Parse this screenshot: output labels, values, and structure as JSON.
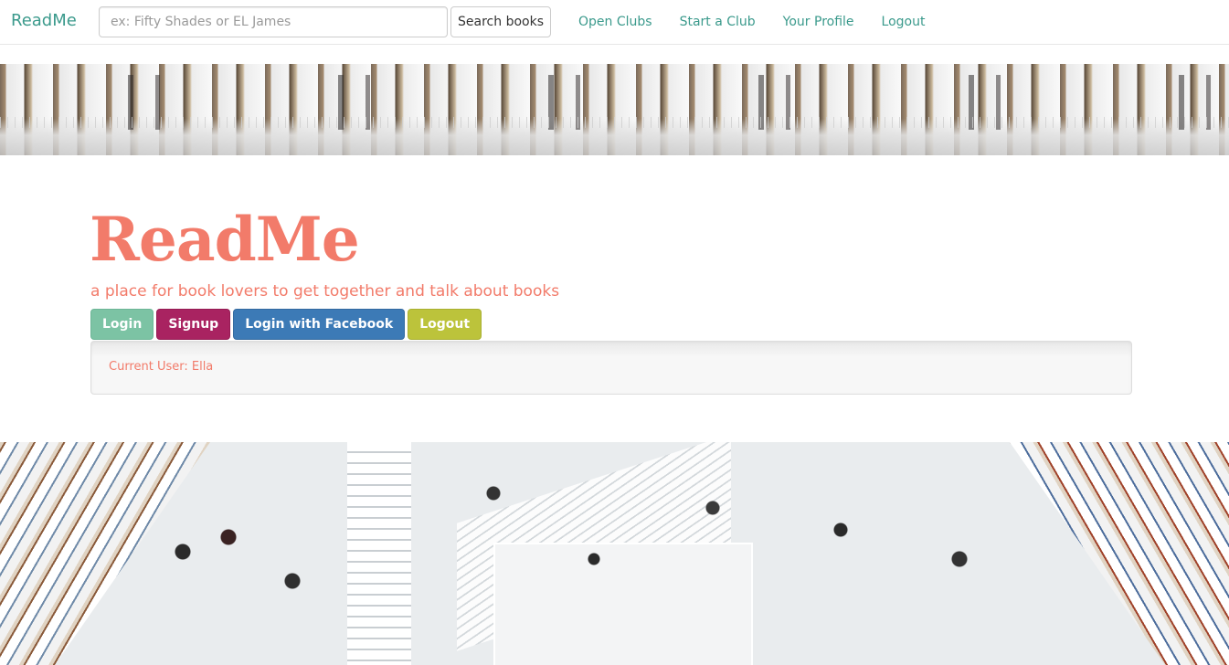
{
  "navbar": {
    "brand": "ReadMe",
    "search_placeholder": "ex: Fifty Shades or EL James",
    "search_button": "Search books",
    "links": [
      "Open Clubs",
      "Start a Club",
      "Your Profile",
      "Logout"
    ]
  },
  "hero": {
    "title": "ReadMe",
    "tagline": "a place for book lovers to get together and talk about books",
    "buttons": {
      "login": "Login",
      "signup": "Signup",
      "facebook": "Login with Facebook",
      "logout": "Logout"
    },
    "current_user": "Current User: Ella"
  },
  "colors": {
    "accent": "#f27b6a",
    "nav_link": "#3b9a8c",
    "login": "#7cc3a4",
    "signup": "#a92361",
    "facebook": "#3c7ab6",
    "logout": "#bcc33b"
  }
}
